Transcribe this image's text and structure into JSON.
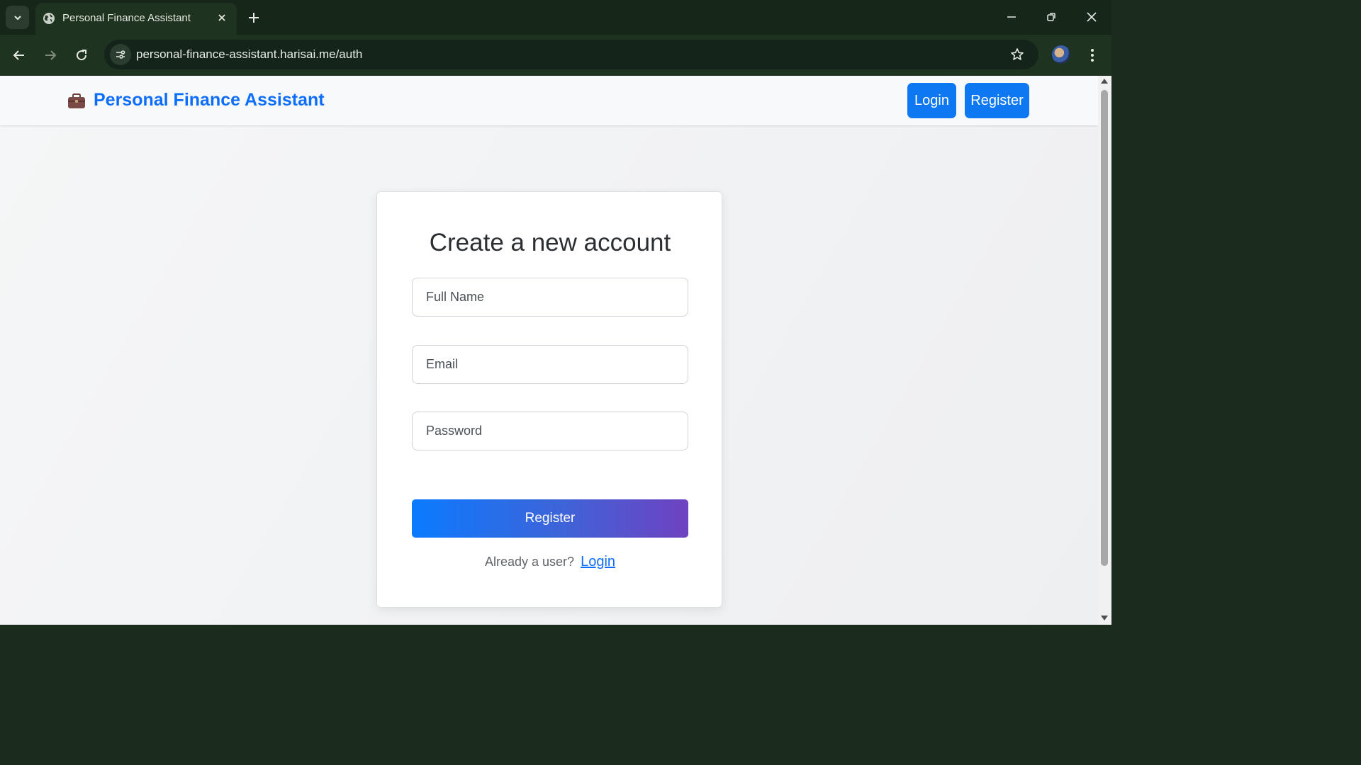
{
  "browser": {
    "tab_title": "Personal Finance Assistant",
    "url": "personal-finance-assistant.harisai.me/auth",
    "icons": [
      "tab-search-icon",
      "globe-icon",
      "close-icon",
      "plus-icon",
      "minimize-icon",
      "restore-icon",
      "window-close-icon",
      "back-arrow-icon",
      "forward-arrow-icon",
      "reload-icon",
      "site-settings-icon",
      "star-icon",
      "avatar",
      "kebab-menu-icon"
    ]
  },
  "navbar": {
    "brand_icon": "briefcase-icon",
    "brand": "Personal Finance Assistant",
    "login_label": "Login",
    "register_label": "Register",
    "accent_color": "#0d6efd"
  },
  "form": {
    "title": "Create a new account",
    "full_name_placeholder": "Full Name",
    "email_placeholder": "Email",
    "password_placeholder": "Password",
    "submit_label": "Register",
    "footer_text": "Already a user?",
    "footer_link": "Login"
  }
}
